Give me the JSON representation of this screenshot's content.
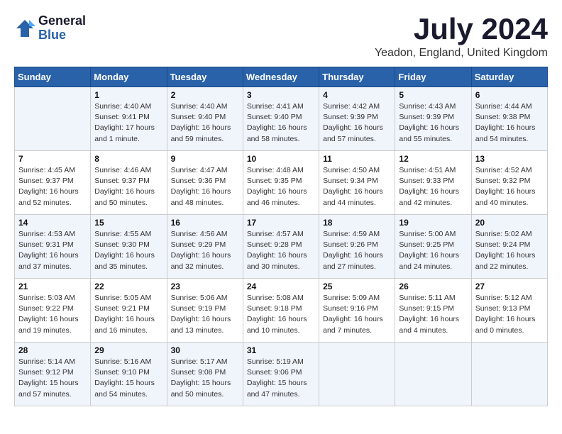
{
  "logo": {
    "line1": "General",
    "line2": "Blue",
    "icon_color": "#2962a8"
  },
  "title": "July 2024",
  "location": "Yeadon, England, United Kingdom",
  "headers": [
    "Sunday",
    "Monday",
    "Tuesday",
    "Wednesday",
    "Thursday",
    "Friday",
    "Saturday"
  ],
  "weeks": [
    [
      {
        "day": "",
        "sunrise": "",
        "sunset": "",
        "daylight": ""
      },
      {
        "day": "1",
        "sunrise": "Sunrise: 4:40 AM",
        "sunset": "Sunset: 9:41 PM",
        "daylight": "Daylight: 17 hours and 1 minute."
      },
      {
        "day": "2",
        "sunrise": "Sunrise: 4:40 AM",
        "sunset": "Sunset: 9:40 PM",
        "daylight": "Daylight: 16 hours and 59 minutes."
      },
      {
        "day": "3",
        "sunrise": "Sunrise: 4:41 AM",
        "sunset": "Sunset: 9:40 PM",
        "daylight": "Daylight: 16 hours and 58 minutes."
      },
      {
        "day": "4",
        "sunrise": "Sunrise: 4:42 AM",
        "sunset": "Sunset: 9:39 PM",
        "daylight": "Daylight: 16 hours and 57 minutes."
      },
      {
        "day": "5",
        "sunrise": "Sunrise: 4:43 AM",
        "sunset": "Sunset: 9:39 PM",
        "daylight": "Daylight: 16 hours and 55 minutes."
      },
      {
        "day": "6",
        "sunrise": "Sunrise: 4:44 AM",
        "sunset": "Sunset: 9:38 PM",
        "daylight": "Daylight: 16 hours and 54 minutes."
      }
    ],
    [
      {
        "day": "7",
        "sunrise": "Sunrise: 4:45 AM",
        "sunset": "Sunset: 9:37 PM",
        "daylight": "Daylight: 16 hours and 52 minutes."
      },
      {
        "day": "8",
        "sunrise": "Sunrise: 4:46 AM",
        "sunset": "Sunset: 9:37 PM",
        "daylight": "Daylight: 16 hours and 50 minutes."
      },
      {
        "day": "9",
        "sunrise": "Sunrise: 4:47 AM",
        "sunset": "Sunset: 9:36 PM",
        "daylight": "Daylight: 16 hours and 48 minutes."
      },
      {
        "day": "10",
        "sunrise": "Sunrise: 4:48 AM",
        "sunset": "Sunset: 9:35 PM",
        "daylight": "Daylight: 16 hours and 46 minutes."
      },
      {
        "day": "11",
        "sunrise": "Sunrise: 4:50 AM",
        "sunset": "Sunset: 9:34 PM",
        "daylight": "Daylight: 16 hours and 44 minutes."
      },
      {
        "day": "12",
        "sunrise": "Sunrise: 4:51 AM",
        "sunset": "Sunset: 9:33 PM",
        "daylight": "Daylight: 16 hours and 42 minutes."
      },
      {
        "day": "13",
        "sunrise": "Sunrise: 4:52 AM",
        "sunset": "Sunset: 9:32 PM",
        "daylight": "Daylight: 16 hours and 40 minutes."
      }
    ],
    [
      {
        "day": "14",
        "sunrise": "Sunrise: 4:53 AM",
        "sunset": "Sunset: 9:31 PM",
        "daylight": "Daylight: 16 hours and 37 minutes."
      },
      {
        "day": "15",
        "sunrise": "Sunrise: 4:55 AM",
        "sunset": "Sunset: 9:30 PM",
        "daylight": "Daylight: 16 hours and 35 minutes."
      },
      {
        "day": "16",
        "sunrise": "Sunrise: 4:56 AM",
        "sunset": "Sunset: 9:29 PM",
        "daylight": "Daylight: 16 hours and 32 minutes."
      },
      {
        "day": "17",
        "sunrise": "Sunrise: 4:57 AM",
        "sunset": "Sunset: 9:28 PM",
        "daylight": "Daylight: 16 hours and 30 minutes."
      },
      {
        "day": "18",
        "sunrise": "Sunrise: 4:59 AM",
        "sunset": "Sunset: 9:26 PM",
        "daylight": "Daylight: 16 hours and 27 minutes."
      },
      {
        "day": "19",
        "sunrise": "Sunrise: 5:00 AM",
        "sunset": "Sunset: 9:25 PM",
        "daylight": "Daylight: 16 hours and 24 minutes."
      },
      {
        "day": "20",
        "sunrise": "Sunrise: 5:02 AM",
        "sunset": "Sunset: 9:24 PM",
        "daylight": "Daylight: 16 hours and 22 minutes."
      }
    ],
    [
      {
        "day": "21",
        "sunrise": "Sunrise: 5:03 AM",
        "sunset": "Sunset: 9:22 PM",
        "daylight": "Daylight: 16 hours and 19 minutes."
      },
      {
        "day": "22",
        "sunrise": "Sunrise: 5:05 AM",
        "sunset": "Sunset: 9:21 PM",
        "daylight": "Daylight: 16 hours and 16 minutes."
      },
      {
        "day": "23",
        "sunrise": "Sunrise: 5:06 AM",
        "sunset": "Sunset: 9:19 PM",
        "daylight": "Daylight: 16 hours and 13 minutes."
      },
      {
        "day": "24",
        "sunrise": "Sunrise: 5:08 AM",
        "sunset": "Sunset: 9:18 PM",
        "daylight": "Daylight: 16 hours and 10 minutes."
      },
      {
        "day": "25",
        "sunrise": "Sunrise: 5:09 AM",
        "sunset": "Sunset: 9:16 PM",
        "daylight": "Daylight: 16 hours and 7 minutes."
      },
      {
        "day": "26",
        "sunrise": "Sunrise: 5:11 AM",
        "sunset": "Sunset: 9:15 PM",
        "daylight": "Daylight: 16 hours and 4 minutes."
      },
      {
        "day": "27",
        "sunrise": "Sunrise: 5:12 AM",
        "sunset": "Sunset: 9:13 PM",
        "daylight": "Daylight: 16 hours and 0 minutes."
      }
    ],
    [
      {
        "day": "28",
        "sunrise": "Sunrise: 5:14 AM",
        "sunset": "Sunset: 9:12 PM",
        "daylight": "Daylight: 15 hours and 57 minutes."
      },
      {
        "day": "29",
        "sunrise": "Sunrise: 5:16 AM",
        "sunset": "Sunset: 9:10 PM",
        "daylight": "Daylight: 15 hours and 54 minutes."
      },
      {
        "day": "30",
        "sunrise": "Sunrise: 5:17 AM",
        "sunset": "Sunset: 9:08 PM",
        "daylight": "Daylight: 15 hours and 50 minutes."
      },
      {
        "day": "31",
        "sunrise": "Sunrise: 5:19 AM",
        "sunset": "Sunset: 9:06 PM",
        "daylight": "Daylight: 15 hours and 47 minutes."
      },
      {
        "day": "",
        "sunrise": "",
        "sunset": "",
        "daylight": ""
      },
      {
        "day": "",
        "sunrise": "",
        "sunset": "",
        "daylight": ""
      },
      {
        "day": "",
        "sunrise": "",
        "sunset": "",
        "daylight": ""
      }
    ]
  ]
}
